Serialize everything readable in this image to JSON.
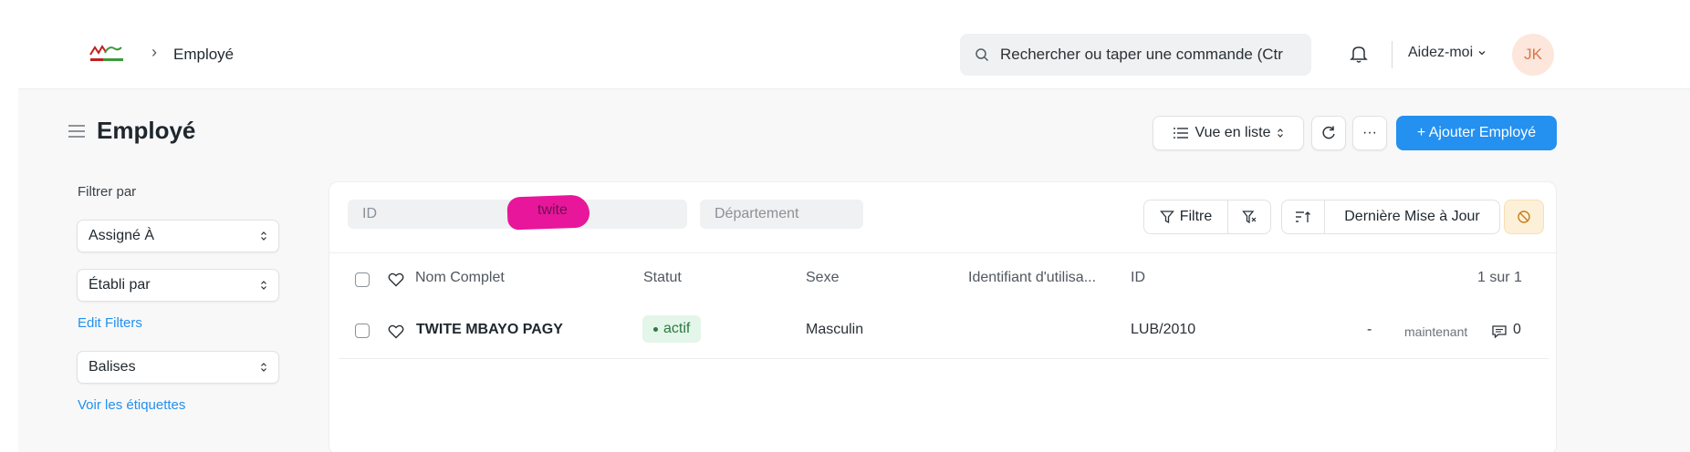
{
  "navbar": {
    "breadcrumb_sep": "›",
    "breadcrumb": "Employé",
    "search_placeholder": "Rechercher ou taper une commande (Ctr",
    "help_label": "Aidez-moi",
    "avatar_initials": "JK"
  },
  "page": {
    "title": "Employé",
    "view_mode_label": "Vue en liste",
    "more_label": "···",
    "add_button_label": "+ Ajouter Employé"
  },
  "sidebar": {
    "filter_title": "Filtrer par",
    "assigned_to": "Assigné À",
    "created_by": "Établi par",
    "edit_filters": "Edit Filters",
    "tags": "Balises",
    "show_tags": "Voir les étiquettes"
  },
  "list": {
    "filters": {
      "id_placeholder": "ID",
      "name_value": "twite",
      "department_placeholder": "Département"
    },
    "filter_label": "Filtre",
    "sort_label": "Dernière Mise à Jour",
    "columns": [
      "Nom Complet",
      "Statut",
      "Sexe",
      "Identifiant d'utilisa...",
      "ID"
    ],
    "count": "1 sur 1",
    "rows": [
      {
        "name": "TWITE MBAYO PAGY",
        "status": "actif",
        "gender": "Masculin",
        "user_id": "",
        "id": "LUB/2010",
        "dash": "-",
        "modified": "maintenant",
        "comments": "0"
      }
    ]
  },
  "colors": {
    "primary": "#2490ef",
    "status_green": "#2b7a41",
    "highlight_magenta": "#e8169a",
    "avatar_bg": "#fde6db"
  }
}
